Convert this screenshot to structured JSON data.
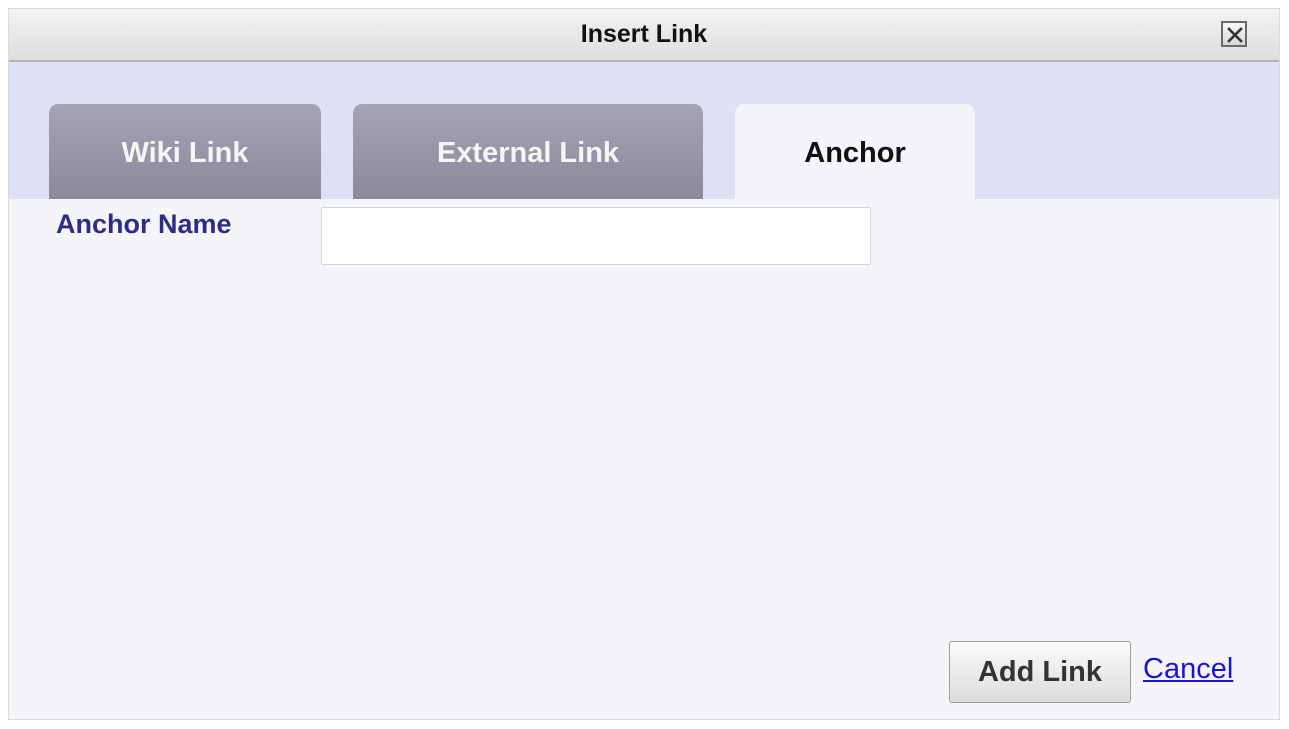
{
  "dialog": {
    "title": "Insert Link",
    "close_icon": "close-icon"
  },
  "tabs": [
    {
      "label": "Wiki Link",
      "active": false
    },
    {
      "label": "External Link",
      "active": false
    },
    {
      "label": "Anchor",
      "active": true
    }
  ],
  "form": {
    "anchor_name_label": "Anchor Name",
    "anchor_name_value": "",
    "anchor_name_placeholder": ""
  },
  "actions": {
    "add_link_label": "Add Link",
    "cancel_label": "Cancel"
  },
  "colors": {
    "tabstrip_bg": "#dde1f3",
    "inactive_tab": "#8a8999",
    "label_text": "#2e2d86",
    "link_text": "#1a12d9"
  }
}
